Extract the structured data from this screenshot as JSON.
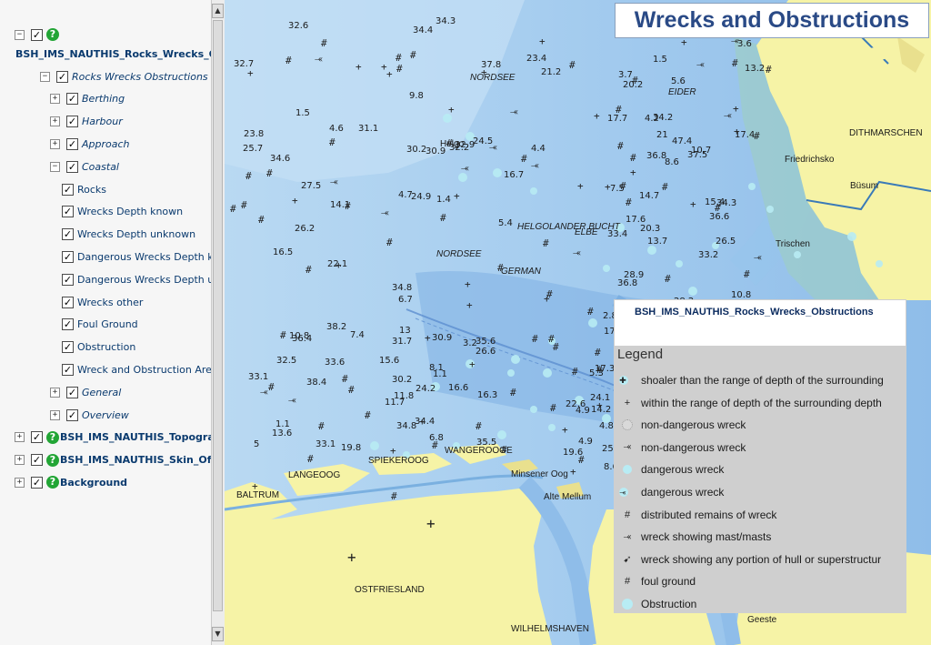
{
  "tree": {
    "nodes": [
      {
        "label": "BSH_IMS_NAUTHIS_Rocks_Wrecks_Obst",
        "style": "bold",
        "expander": "−",
        "checked": true,
        "help": true,
        "indent": 0,
        "labelBelow": true
      },
      {
        "label": "Rocks Wrecks Obstructions",
        "style": "ital",
        "expander": "−",
        "checked": true,
        "help": false,
        "indent": 1
      },
      {
        "label": "Berthing",
        "style": "ital",
        "expander": "+",
        "checked": true,
        "help": false,
        "indent": 2
      },
      {
        "label": "Harbour",
        "style": "ital",
        "expander": "+",
        "checked": true,
        "help": false,
        "indent": 2
      },
      {
        "label": "Approach",
        "style": "ital",
        "expander": "+",
        "checked": true,
        "help": false,
        "indent": 2
      },
      {
        "label": "Coastal",
        "style": "ital",
        "expander": "−",
        "checked": true,
        "help": false,
        "indent": 2
      },
      {
        "label": "Rocks",
        "style": "plain",
        "expander": "",
        "checked": true,
        "help": false,
        "indent": 3
      },
      {
        "label": "Wrecks Depth known",
        "style": "plain",
        "expander": "",
        "checked": true,
        "help": false,
        "indent": 3
      },
      {
        "label": "Wrecks Depth unknown",
        "style": "plain",
        "expander": "",
        "checked": true,
        "help": false,
        "indent": 3
      },
      {
        "label": "Dangerous Wrecks Depth know",
        "style": "plain",
        "expander": "",
        "checked": true,
        "help": false,
        "indent": 3
      },
      {
        "label": "Dangerous Wrecks Depth unkn",
        "style": "plain",
        "expander": "",
        "checked": true,
        "help": false,
        "indent": 3
      },
      {
        "label": "Wrecks other",
        "style": "plain",
        "expander": "",
        "checked": true,
        "help": false,
        "indent": 3
      },
      {
        "label": "Foul Ground",
        "style": "plain",
        "expander": "",
        "checked": true,
        "help": false,
        "indent": 3
      },
      {
        "label": "Obstruction",
        "style": "plain",
        "expander": "",
        "checked": true,
        "help": false,
        "indent": 3
      },
      {
        "label": "Wreck and Obstruction Area",
        "style": "plain",
        "expander": "",
        "checked": true,
        "help": false,
        "indent": 3
      },
      {
        "label": "General",
        "style": "ital",
        "expander": "+",
        "checked": true,
        "help": false,
        "indent": 2
      },
      {
        "label": "Overview",
        "style": "ital",
        "expander": "+",
        "checked": true,
        "help": false,
        "indent": 2
      },
      {
        "label": "BSH_IMS_NAUTHIS_Topography",
        "style": "bold",
        "expander": "+",
        "checked": true,
        "help": true,
        "indent": 0
      },
      {
        "label": "BSH_IMS_NAUTHIS_Skin_Of_Th",
        "style": "bold",
        "expander": "+",
        "checked": true,
        "help": true,
        "indent": 0
      },
      {
        "label": "Background",
        "style": "bold",
        "expander": "+",
        "checked": true,
        "help": true,
        "indent": 0
      }
    ]
  },
  "scrollbar": {
    "up": "▲",
    "down": "▼"
  },
  "title": "Wrecks and Obstructions",
  "legend": {
    "layer_name": "BSH_IMS_NAUTHIS_Rocks_Wrecks_Obstructions",
    "heading": "Legend",
    "items": [
      {
        "icon": "✚",
        "kind": "dot-cyan-plus",
        "label": "shoaler than the range of depth of the surrounding"
      },
      {
        "icon": "+",
        "kind": "plus",
        "label": "within the range of depth of the surrounding depth"
      },
      {
        "icon": "",
        "kind": "dot-grey",
        "label": "non-dangerous wreck"
      },
      {
        "icon": "⤛",
        "kind": "hull",
        "label": "non-dangerous wreck"
      },
      {
        "icon": "",
        "kind": "dot-cyan",
        "label": "dangerous wreck"
      },
      {
        "icon": "⤛",
        "kind": "dot-hull",
        "label": "dangerous wreck"
      },
      {
        "icon": "#",
        "kind": "hash",
        "label": "distributed remains of wreck"
      },
      {
        "icon": "⤛",
        "kind": "mast",
        "label": "wreck showing mast/masts"
      },
      {
        "icon": "➹",
        "kind": "hullpart",
        "label": "wreck showing any portion of hull or superstructur"
      },
      {
        "icon": "#",
        "kind": "hash",
        "label": "foul ground"
      },
      {
        "icon": "",
        "kind": "dot-cyan-big",
        "label": "Obstruction"
      }
    ]
  },
  "map": {
    "places": [
      {
        "text": "NORDSEE",
        "ital": true
      },
      {
        "text": "EIDER",
        "ital": true
      },
      {
        "text": "DITHMARSCHEN",
        "ital": false
      },
      {
        "text": "Helgo",
        "ital": false
      },
      {
        "text": "Friedrichsko",
        "ital": false
      },
      {
        "text": "Büsum",
        "ital": false
      },
      {
        "text": "Trischen",
        "ital": false
      },
      {
        "text": "HELGOLANDER BUCHT",
        "ital": true
      },
      {
        "text": "ELBE",
        "ital": true
      },
      {
        "text": "NORDSEE",
        "ital": true
      },
      {
        "text": "GERMAN",
        "ital": true
      },
      {
        "text": "LANGEOOG",
        "ital": false
      },
      {
        "text": "SPIEKEROOG",
        "ital": false
      },
      {
        "text": "WANGEROOGE",
        "ital": false
      },
      {
        "text": "BALTRUM",
        "ital": false
      },
      {
        "text": "Minsener Oog",
        "ital": false
      },
      {
        "text": "Alte Mellum",
        "ital": false
      },
      {
        "text": "OSTFRIESLAND",
        "ital": false
      },
      {
        "text": "WILHELMSHAVEN",
        "ital": false
      },
      {
        "text": "Geeste",
        "ital": false
      }
    ],
    "depths": [
      "24.9",
      "20.2",
      "11.8",
      "25.8",
      "32.2",
      "13.7",
      "35.6",
      "36.8",
      "37.8",
      "37.5",
      "36.4",
      "35.8",
      "34.6",
      "13.2",
      "11.7",
      "9",
      "10.8",
      "5.6",
      "1.1",
      "27.7",
      "31.1",
      "36.8",
      "33.1",
      "33.1",
      "32.9",
      "34.3",
      "32.5",
      "23.6",
      "25.7",
      "15.4",
      "5.3",
      "29.8",
      "34.8",
      "47.4",
      "33.6",
      "38.3",
      "22.1",
      "10.8",
      "4.9",
      "32.4",
      "34.3",
      "34.2",
      "38.4",
      "2.4",
      "38.2",
      "17.7",
      "16.6",
      "8.6",
      "6.7",
      "10.7",
      "13.6",
      "12.6",
      "32.7",
      "36.6",
      "35.5",
      "36.8",
      "32.6",
      "12.4",
      "6.8",
      "31.9",
      "34.4",
      "36.8",
      "33.1",
      "37.3",
      "23.4",
      "14.5",
      "3.2",
      "29.7",
      "30.2",
      "33.4",
      "34.8",
      "29.8",
      "5.4",
      "4.2",
      "5",
      "2.8",
      "1.5",
      "7.5",
      "30.2",
      "33.4",
      "30.9",
      "28.9",
      "16.3",
      "18.6",
      "13",
      "17.4",
      "34.4",
      "32.1",
      "30.9",
      "33.2",
      "31.7",
      "29.1",
      "24.5",
      "26.5",
      "24.2",
      "25.6",
      "23.8",
      "28.2",
      "26.6",
      "26.3",
      "27.5",
      "25.8",
      "24.1",
      "17.3",
      "26.2",
      "20.3",
      "19.8",
      "21.8",
      "21.2",
      "21",
      "22.6",
      "17.1",
      "9.8",
      "8.6",
      "7.4",
      "4.8",
      "4.7",
      "3.6",
      "15.6",
      "14.6",
      "16.5",
      "14.5",
      "8.1",
      "9.2",
      "16.7",
      "14.7",
      "19.6",
      "11.9",
      "4.4",
      "3.7",
      "1.1",
      "6.9",
      "4.6",
      "1.5",
      "4.9",
      "3.7",
      "14.1",
      "17.6",
      "14.2",
      "22.1",
      "1.4"
    ]
  }
}
